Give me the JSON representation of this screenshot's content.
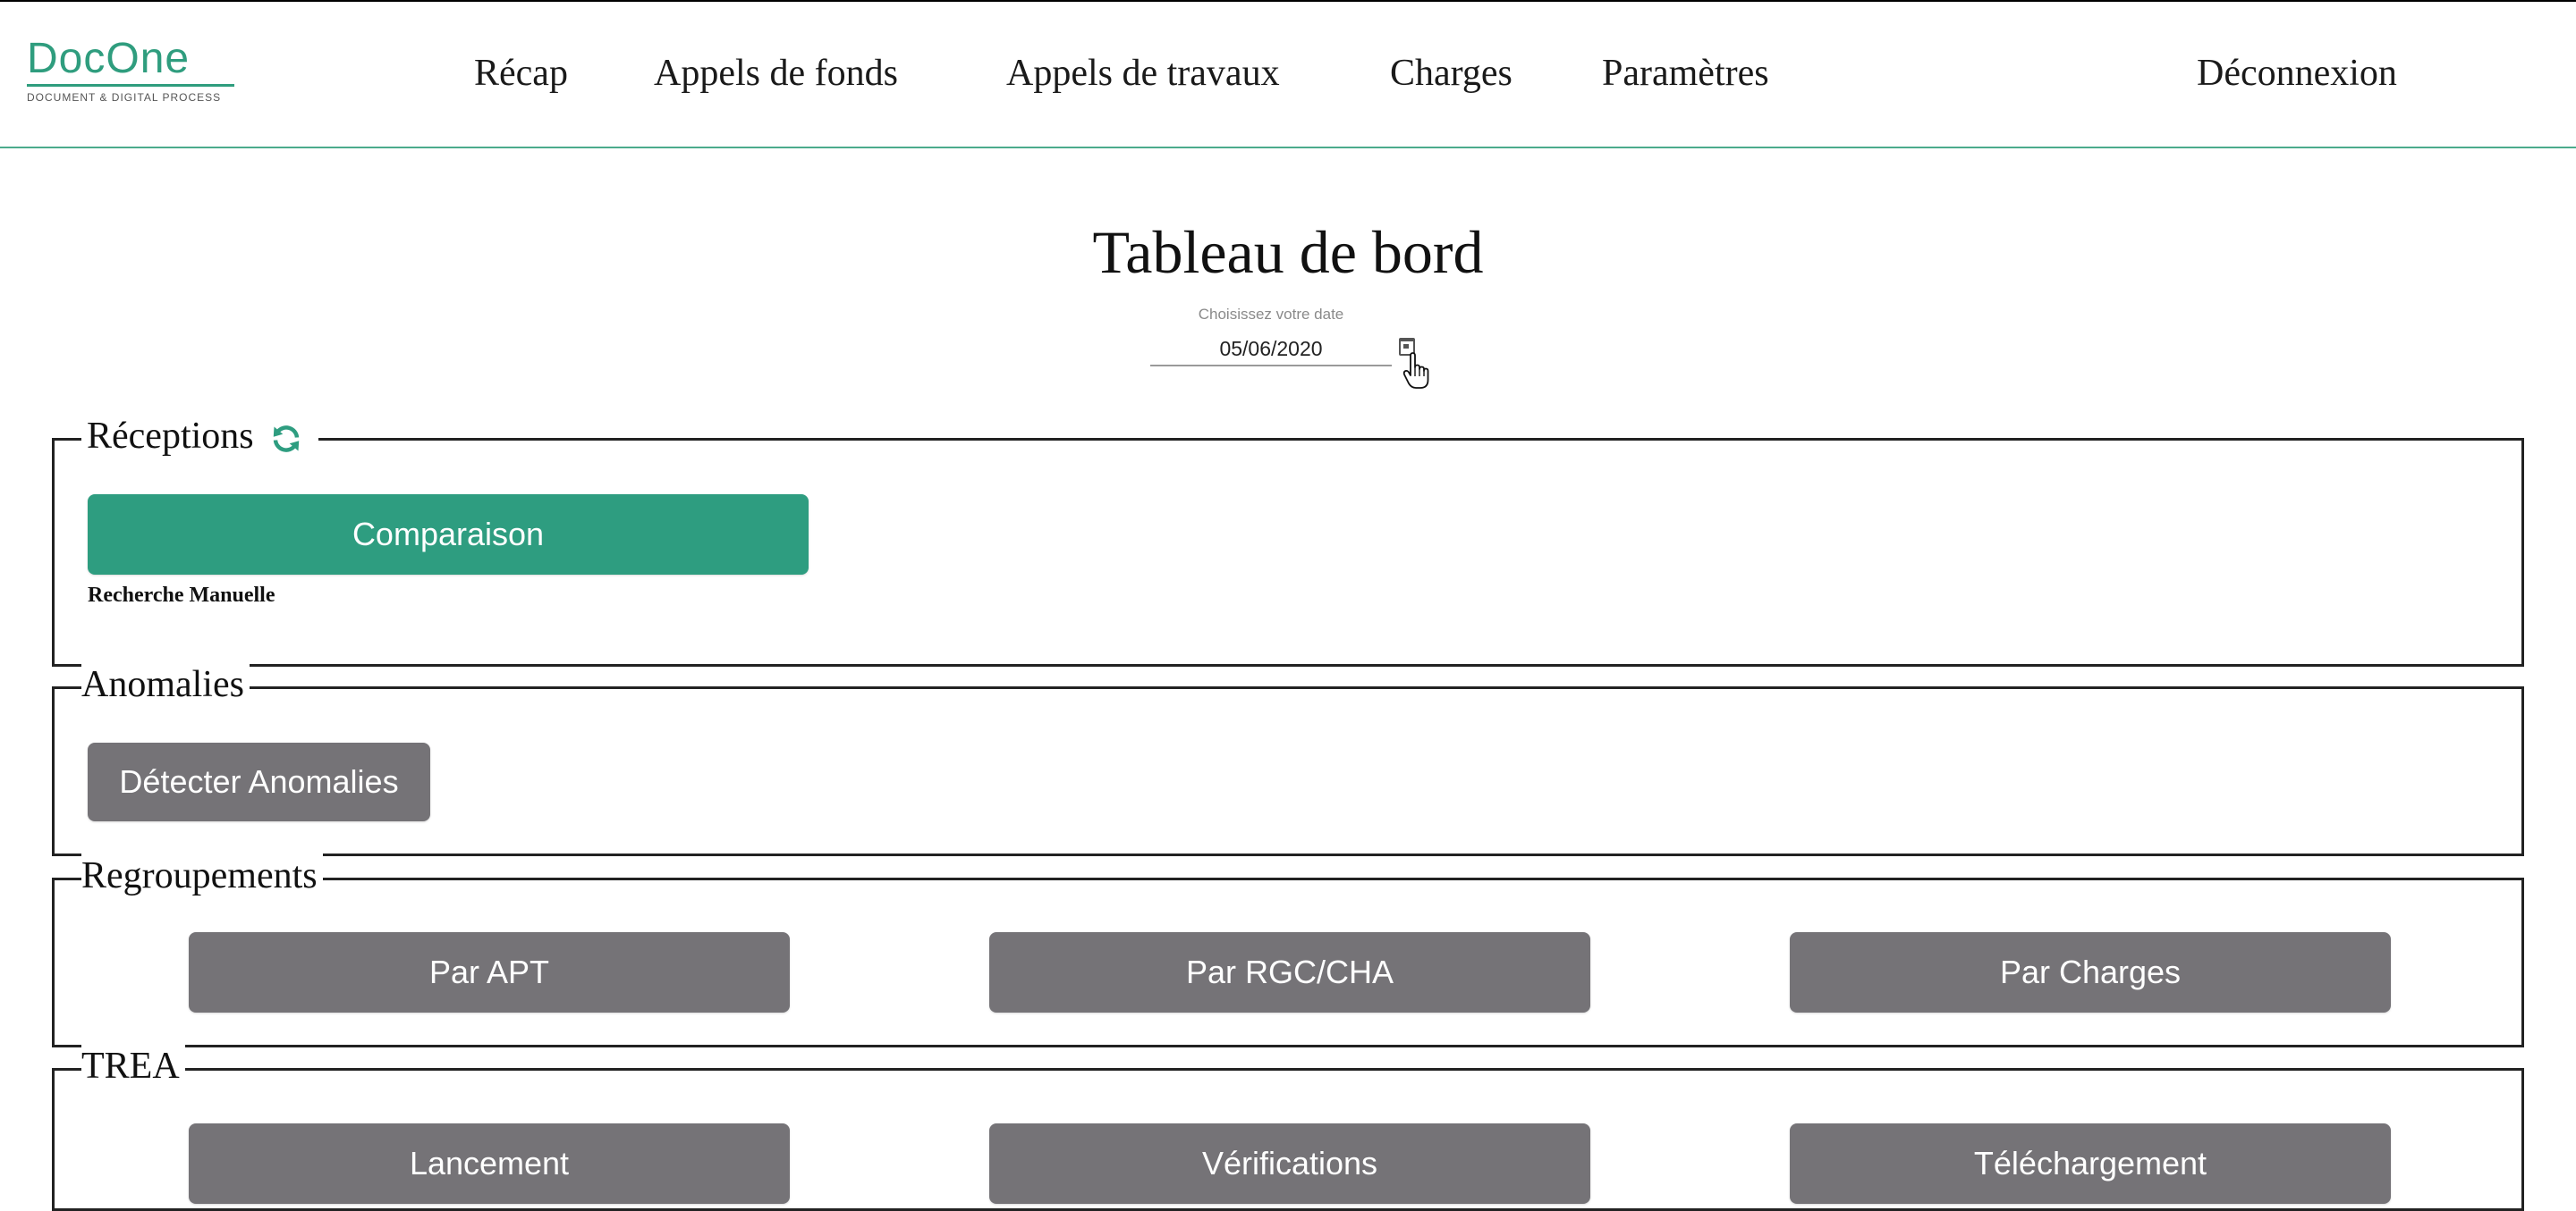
{
  "logo": {
    "name": "DocOne",
    "tagline": "DOCUMENT & DIGITAL PROCESS"
  },
  "nav": {
    "items": [
      {
        "label": "Récap"
      },
      {
        "label": "Appels de fonds"
      },
      {
        "label": "Appels de travaux"
      },
      {
        "label": "Charges"
      },
      {
        "label": "Paramètres"
      }
    ],
    "logout": "Déconnexion"
  },
  "page": {
    "title": "Tableau de bord",
    "date": {
      "label": "Choisissez votre date",
      "value": "05/06/2020"
    }
  },
  "sections": {
    "receptions": {
      "title": "Réceptions",
      "button": "Comparaison",
      "caption": "Recherche Manuelle"
    },
    "anomalies": {
      "title": "Anomalies",
      "button": "Détecter Anomalies"
    },
    "regroupements": {
      "title": "Regroupements",
      "buttons": [
        "Par APT",
        "Par RGC/CHA",
        "Par Charges"
      ]
    },
    "trea": {
      "title": "TREA",
      "buttons": [
        "Lancement",
        "Vérifications",
        "Téléchargement"
      ]
    }
  },
  "colors": {
    "accent": "#2e9d80",
    "button_gray": "#757377",
    "header_line": "#4bab8c"
  },
  "icons": {
    "refresh": "refresh-icon",
    "calendar": "calendar-icon",
    "cursor": "hand-pointer-icon"
  }
}
